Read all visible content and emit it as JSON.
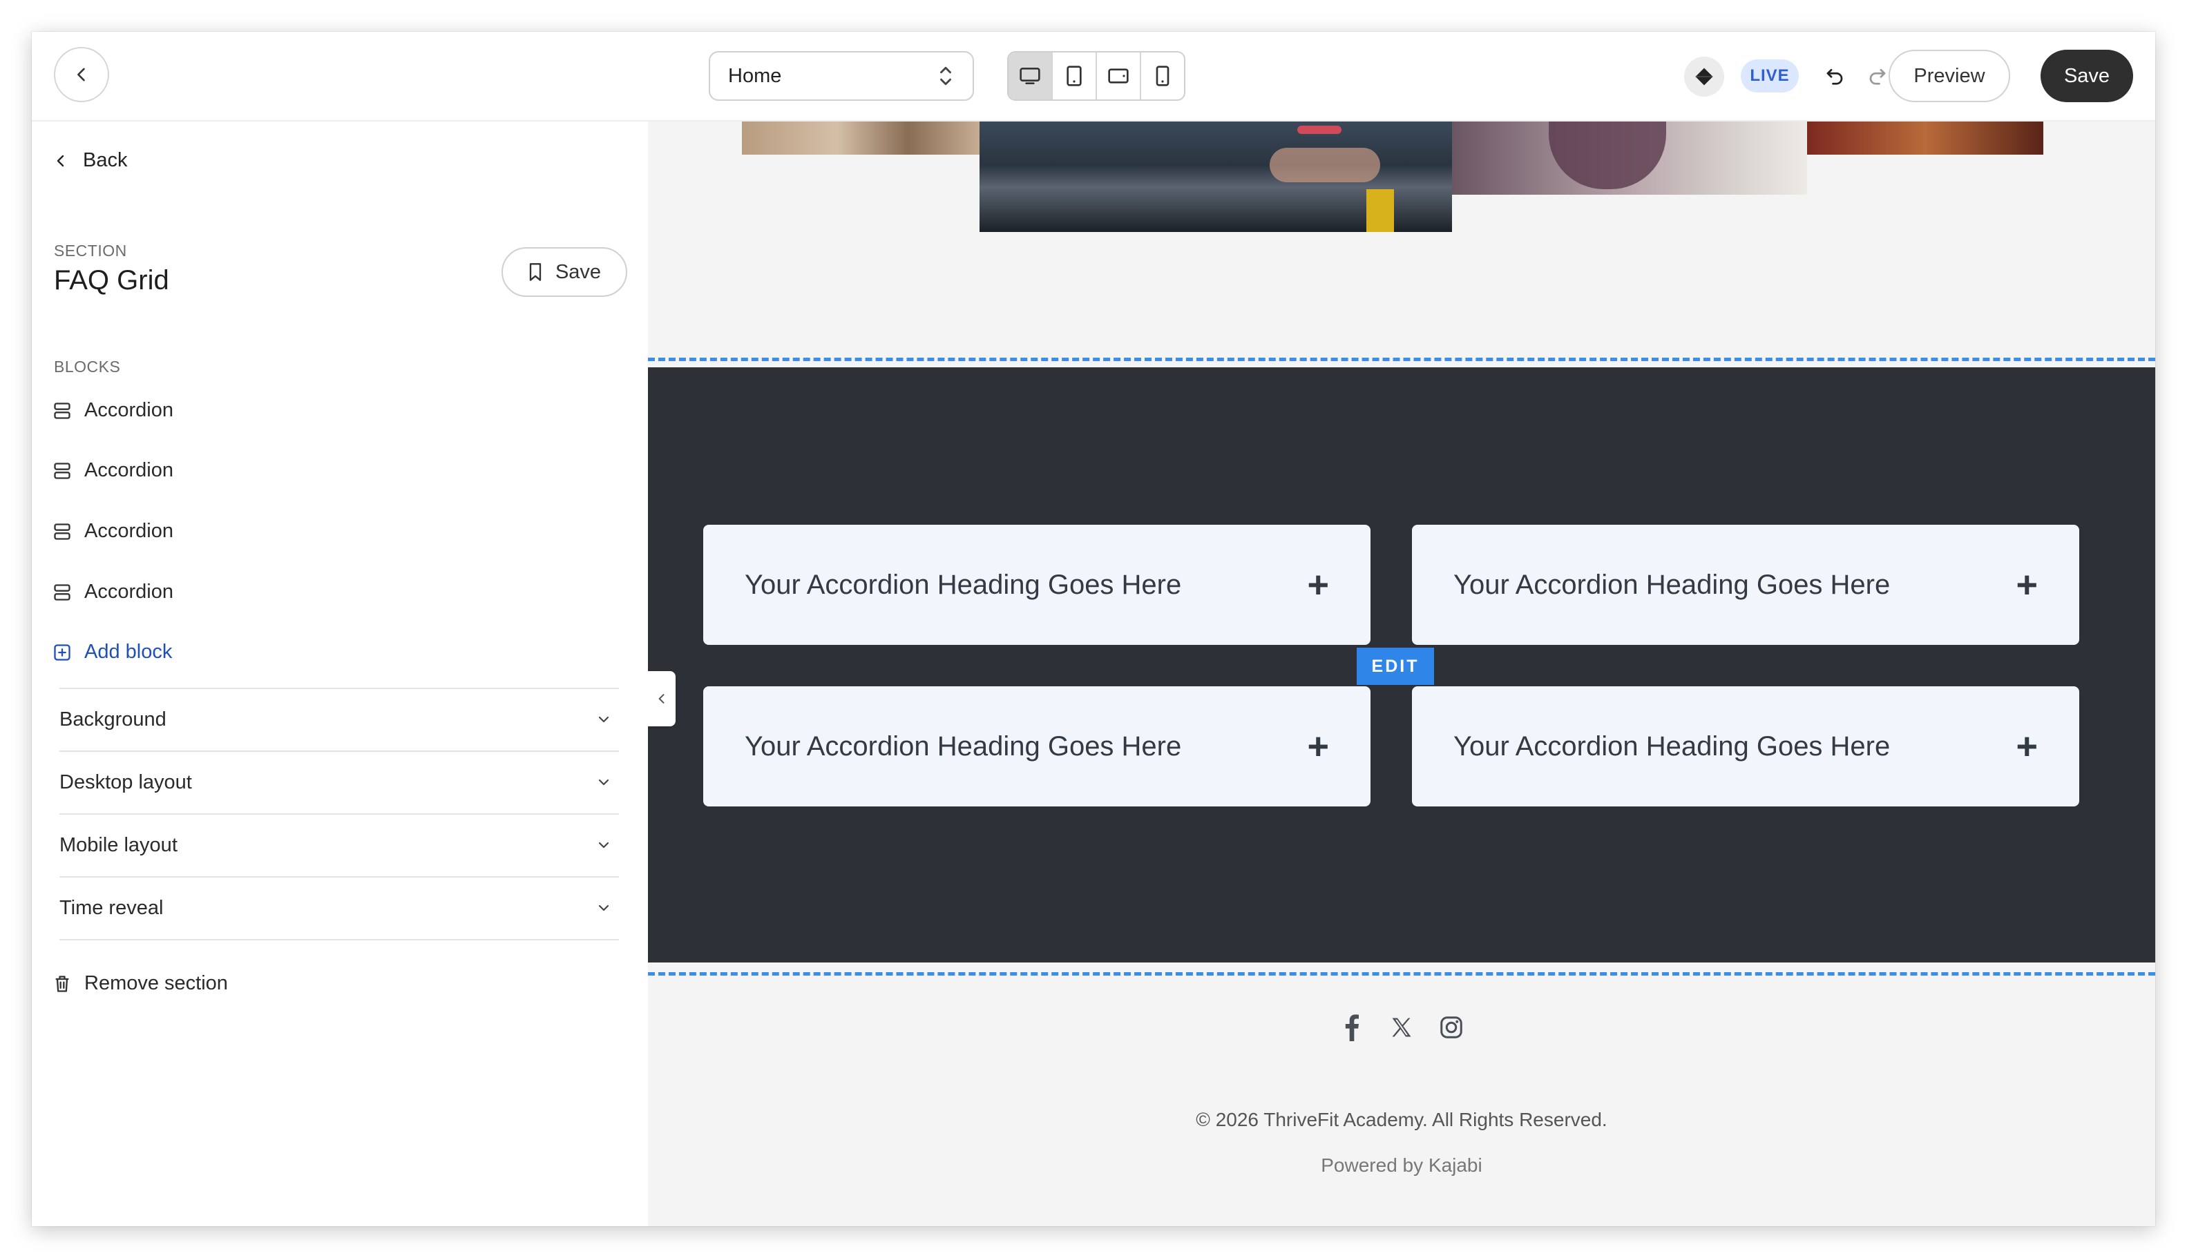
{
  "topbar": {
    "page_selector": "Home",
    "live_badge": "LIVE",
    "preview_label": "Preview",
    "save_label": "Save"
  },
  "sidebar": {
    "back_label": "Back",
    "section_label": "SECTION",
    "section_title": "FAQ Grid",
    "save_label": "Save",
    "blocks_label": "BLOCKS",
    "blocks": [
      {
        "label": "Accordion"
      },
      {
        "label": "Accordion"
      },
      {
        "label": "Accordion"
      },
      {
        "label": "Accordion"
      }
    ],
    "add_block_label": "Add block",
    "settings": [
      {
        "label": "Background"
      },
      {
        "label": "Desktop layout"
      },
      {
        "label": "Mobile layout"
      },
      {
        "label": "Time reveal"
      }
    ],
    "remove_label": "Remove section"
  },
  "canvas": {
    "faq_cards": [
      {
        "heading": "Your Accordion Heading Goes Here"
      },
      {
        "heading": "Your Accordion Heading Goes Here"
      },
      {
        "heading": "Your Accordion Heading Goes Here"
      },
      {
        "heading": "Your Accordion Heading Goes Here"
      }
    ],
    "edit_label": "EDIT",
    "copyright": "© 2026 ThriveFit Academy. All Rights Reserved.",
    "powered_by": "Powered by Kajabi"
  },
  "colors": {
    "accent_blue": "#2f86e8",
    "dark_section": "#2d3036",
    "card_bg": "#f2f6fc",
    "save_button": "#2f2f2f"
  },
  "icons": {
    "back": "chevron-left-icon",
    "bookmark": "bookmark-icon",
    "block": "stacked-rows-icon",
    "add": "plus-square-icon",
    "chevron": "chevron-down-icon",
    "trash": "trash-icon",
    "social": [
      "facebook-icon",
      "x-icon",
      "instagram-icon"
    ]
  }
}
